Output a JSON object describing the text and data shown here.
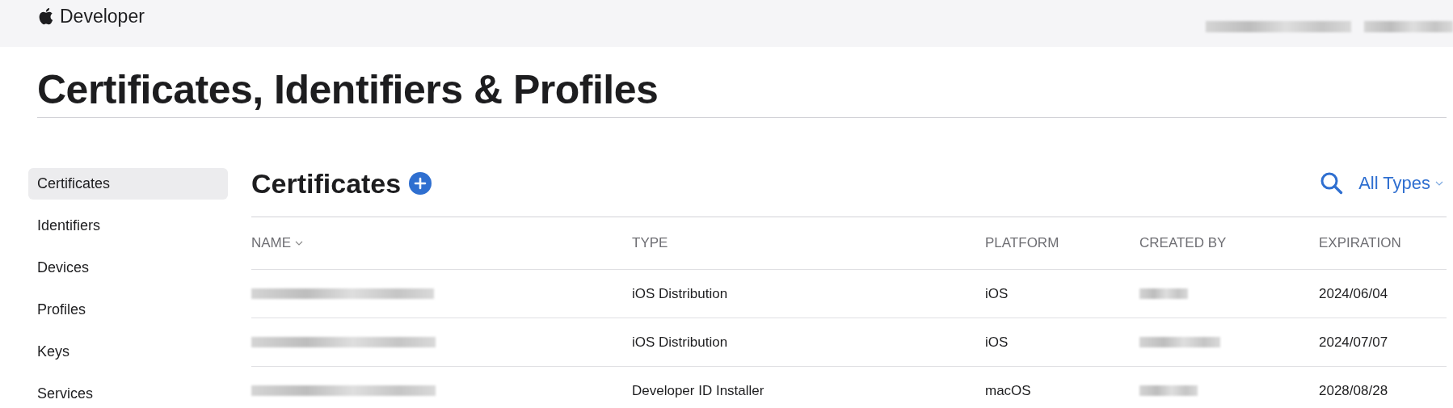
{
  "header": {
    "brand": "Developer"
  },
  "page_title": "Certificates, Identifiers & Profiles",
  "sidebar": {
    "items": [
      {
        "label": "Certificates",
        "selected": true
      },
      {
        "label": "Identifiers",
        "selected": false
      },
      {
        "label": "Devices",
        "selected": false
      },
      {
        "label": "Profiles",
        "selected": false
      },
      {
        "label": "Keys",
        "selected": false
      },
      {
        "label": "Services",
        "selected": false
      }
    ]
  },
  "section": {
    "title": "Certificates",
    "filter": "All Types"
  },
  "table": {
    "columns": [
      {
        "label": "NAME",
        "sorted": true
      },
      {
        "label": "TYPE",
        "sorted": false
      },
      {
        "label": "PLATFORM",
        "sorted": false
      },
      {
        "label": "CREATED BY",
        "sorted": false
      },
      {
        "label": "EXPIRATION",
        "sorted": false
      }
    ],
    "rows": [
      {
        "type": "iOS Distribution",
        "platform": "iOS",
        "expiration": "2024/06/04"
      },
      {
        "type": "iOS Distribution",
        "platform": "iOS",
        "expiration": "2024/07/07"
      },
      {
        "type": "Developer ID Installer",
        "platform": "macOS",
        "expiration": "2028/08/28"
      }
    ]
  }
}
